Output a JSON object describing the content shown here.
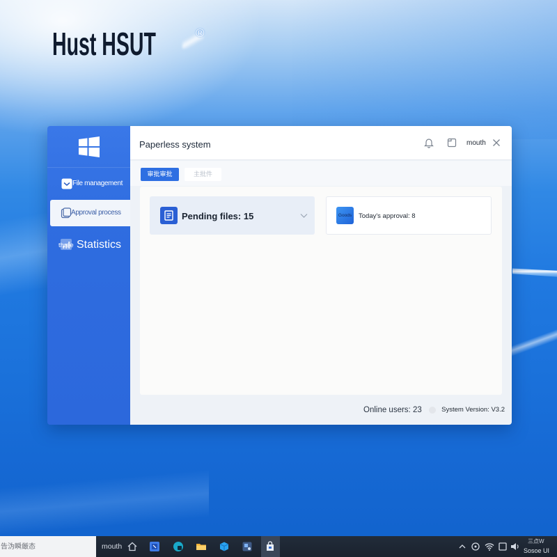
{
  "desktop": {
    "title": "Hust HSUT",
    "trademark": "®"
  },
  "window": {
    "title": "Paperless system",
    "username": "mouth",
    "header_icons": [
      "bell-icon",
      "window-icon",
      "close-icon"
    ]
  },
  "sidebar": {
    "logo_icon": "windows-logo-icon",
    "items": [
      {
        "label": "File management",
        "icon": "checkbox-icon",
        "selected": false
      },
      {
        "label": "Approval process",
        "icon": "tablet-icon",
        "selected": true
      },
      {
        "icon_caption": "three",
        "label": "Statistics",
        "icon": "chart-icon",
        "selected": false
      }
    ]
  },
  "tabs": [
    {
      "label": "审批审批",
      "active": true
    },
    {
      "label": "主批件",
      "active": false
    }
  ],
  "summary_cards": [
    {
      "label": "Pending files: 15",
      "icon": "document-icon",
      "has_dropdown": true
    },
    {
      "label": "Today's approval: 8",
      "icon_text": "Goods"
    }
  ],
  "footer": {
    "online_users": "Online users: 23",
    "system_version": "System Version: V3.2"
  },
  "taskbar": {
    "search_text": "告沩瞬厳态",
    "user_label": "mouth",
    "pinned_apps": [
      "home-icon",
      "mail-app-icon",
      "edge-icon",
      "file-explorer-icon",
      "store-icon",
      "control-panel-icon",
      "active-app-icon"
    ],
    "active_app": "active-app-icon",
    "tray_icons": [
      "chevron-up-icon",
      "status-icon",
      "wifi-icon",
      "tablet-mode-icon",
      "speaker-icon"
    ],
    "clock_line1": "三点W",
    "clock_line2": "Sosoe UI"
  },
  "colors": {
    "sidebar_blue": "#2f6de0",
    "accent_blue": "#2e6fe2",
    "selected_item_text": "#3b5ea6",
    "card_highlight": "#e8eef7",
    "taskbar_bg": "#1d2532",
    "desktop_blue": "#1f78e0"
  }
}
